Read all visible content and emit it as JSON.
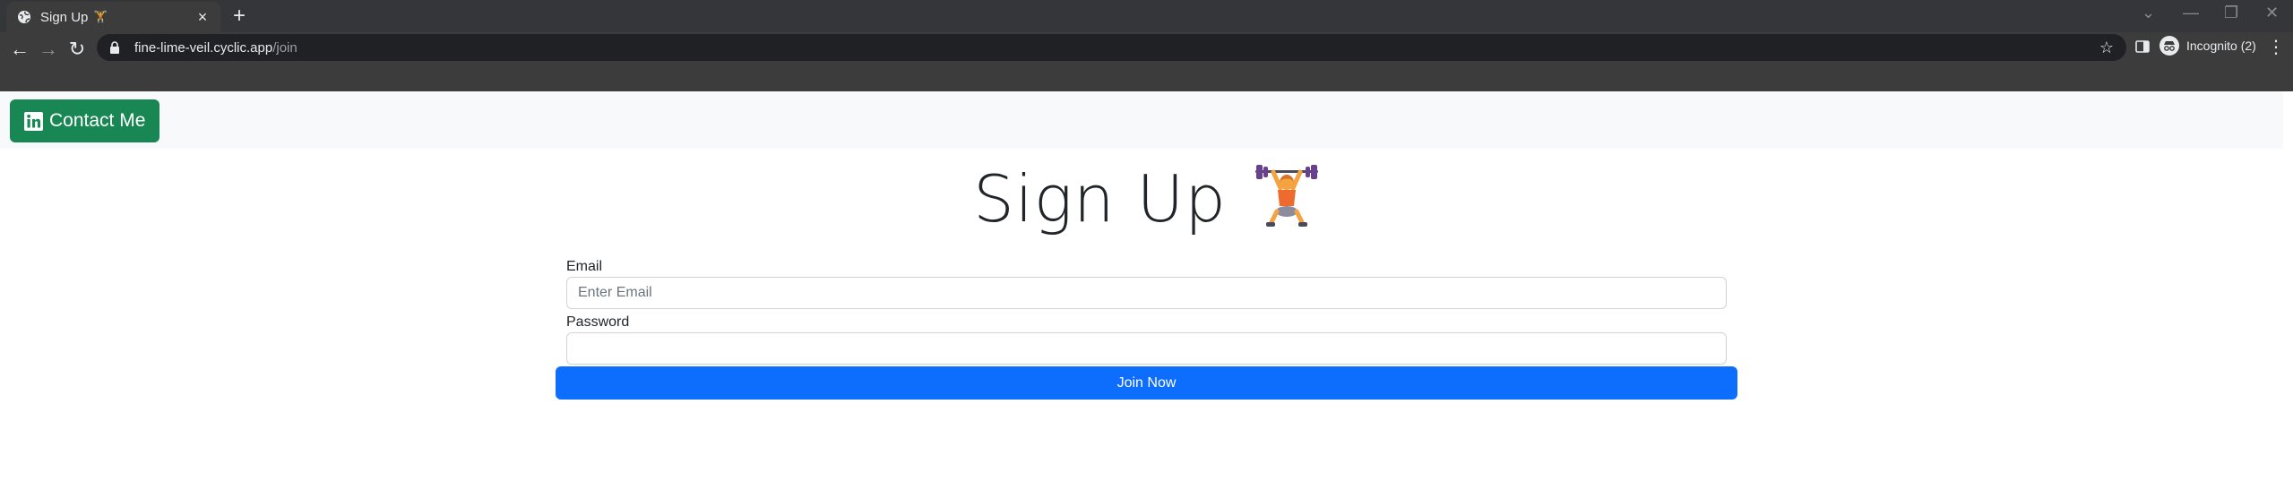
{
  "browser": {
    "tab": {
      "title": "Sign Up",
      "title_emoji": "🏋",
      "favicon": "globe-icon"
    },
    "new_tab_symbol": "+",
    "url": {
      "host": "fine-lime-veil.cyclic.app",
      "path": "/join"
    },
    "profile_label": "Incognito (2)",
    "window_controls": [
      "⌄",
      "—",
      "❐",
      "✕"
    ]
  },
  "navbar": {
    "contact_button_label": "Contact Me",
    "contact_icon": "linkedin-icon"
  },
  "form": {
    "heading": "Sign Up",
    "heading_emoji": "weightlifter-emoji",
    "email_label": "Email",
    "email_placeholder": "Enter Email",
    "email_value": "",
    "password_label": "Password",
    "password_value": "",
    "submit_label": "Join Now"
  },
  "colors": {
    "contact_button": "#198754",
    "submit_button": "#0d6efd",
    "navbar_bg": "#f8f9fa",
    "browser_frame": "#35363a"
  }
}
